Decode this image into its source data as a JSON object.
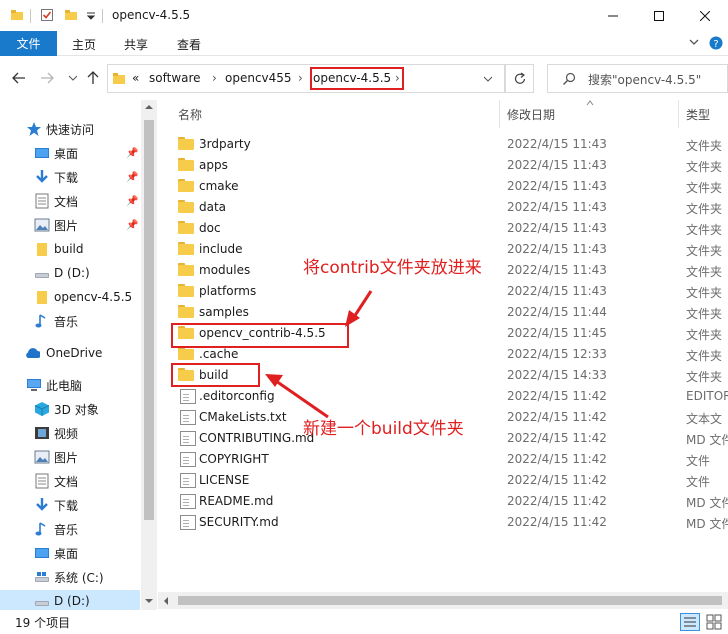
{
  "window": {
    "title": "opencv-4.5.5",
    "min_icon": "minimize-icon",
    "max_icon": "maximize-icon",
    "close_icon": "close-icon"
  },
  "ribbon": {
    "tabs": [
      "文件",
      "主页",
      "共享",
      "查看"
    ]
  },
  "address": {
    "crumbs": [
      "«",
      "software",
      "opencv455",
      "opencv-4.5.5"
    ],
    "search_placeholder": "搜索\"opencv-4.5.5\""
  },
  "nav": {
    "items": [
      {
        "label": "快速访问",
        "icon": "star-icon"
      },
      {
        "label": "桌面",
        "icon": "desktop-icon",
        "pinned": true
      },
      {
        "label": "下载",
        "icon": "download-icon",
        "pinned": true
      },
      {
        "label": "文档",
        "icon": "documents-icon",
        "pinned": true
      },
      {
        "label": "图片",
        "icon": "pictures-icon",
        "pinned": true
      },
      {
        "label": "build",
        "icon": "folder-icon"
      },
      {
        "label": "D (D:)",
        "icon": "drive-icon"
      },
      {
        "label": "opencv-4.5.5",
        "icon": "folder-icon"
      },
      {
        "label": "音乐",
        "icon": "music-icon"
      },
      {
        "label": "OneDrive",
        "icon": "cloud-icon"
      },
      {
        "label": "此电脑",
        "icon": "pc-icon"
      },
      {
        "label": "3D 对象",
        "icon": "3d-objects-icon"
      },
      {
        "label": "视频",
        "icon": "video-icon"
      },
      {
        "label": "图片",
        "icon": "pictures-icon"
      },
      {
        "label": "文档",
        "icon": "documents-icon"
      },
      {
        "label": "下载",
        "icon": "download-icon"
      },
      {
        "label": "音乐",
        "icon": "music-icon"
      },
      {
        "label": "桌面",
        "icon": "desktop-icon"
      },
      {
        "label": "系统 (C:)",
        "icon": "drive-icon"
      },
      {
        "label": "D (D:)",
        "icon": "drive-icon"
      }
    ]
  },
  "columns": {
    "name": "名称",
    "date": "修改日期",
    "type": "类型"
  },
  "files": [
    {
      "name": "3rdparty",
      "date": "2022/4/15 11:43",
      "type": "文件夹",
      "kind": "folder"
    },
    {
      "name": "apps",
      "date": "2022/4/15 11:43",
      "type": "文件夹",
      "kind": "folder"
    },
    {
      "name": "cmake",
      "date": "2022/4/15 11:43",
      "type": "文件夹",
      "kind": "folder"
    },
    {
      "name": "data",
      "date": "2022/4/15 11:43",
      "type": "文件夹",
      "kind": "folder"
    },
    {
      "name": "doc",
      "date": "2022/4/15 11:43",
      "type": "文件夹",
      "kind": "folder"
    },
    {
      "name": "include",
      "date": "2022/4/15 11:43",
      "type": "文件夹",
      "kind": "folder"
    },
    {
      "name": "modules",
      "date": "2022/4/15 11:43",
      "type": "文件夹",
      "kind": "folder"
    },
    {
      "name": "platforms",
      "date": "2022/4/15 11:43",
      "type": "文件夹",
      "kind": "folder"
    },
    {
      "name": "samples",
      "date": "2022/4/15 11:44",
      "type": "文件夹",
      "kind": "folder"
    },
    {
      "name": "opencv_contrib-4.5.5",
      "date": "2022/4/15 11:45",
      "type": "文件夹",
      "kind": "folder"
    },
    {
      "name": ".cache",
      "date": "2022/4/15 12:33",
      "type": "文件夹",
      "kind": "folder"
    },
    {
      "name": "build",
      "date": "2022/4/15 14:33",
      "type": "文件夹",
      "kind": "folder"
    },
    {
      "name": ".editorconfig",
      "date": "2022/4/15 11:42",
      "type": "EDITOR",
      "kind": "file"
    },
    {
      "name": "CMakeLists.txt",
      "date": "2022/4/15 11:42",
      "type": "文本文",
      "kind": "file"
    },
    {
      "name": "CONTRIBUTING.md",
      "date": "2022/4/15 11:42",
      "type": "MD 文件",
      "kind": "file"
    },
    {
      "name": "COPYRIGHT",
      "date": "2022/4/15 11:42",
      "type": "文件",
      "kind": "file"
    },
    {
      "name": "LICENSE",
      "date": "2022/4/15 11:42",
      "type": "文件",
      "kind": "file"
    },
    {
      "name": "README.md",
      "date": "2022/4/15 11:42",
      "type": "MD 文件",
      "kind": "file"
    },
    {
      "name": "SECURITY.md",
      "date": "2022/4/15 11:42",
      "type": "MD 文件",
      "kind": "file"
    }
  ],
  "status": {
    "count": "19 个项目"
  },
  "annotations": {
    "contrib_note": "将contrib文件夹放进来",
    "build_note": "新建一个build文件夹"
  },
  "colors": {
    "accent": "#1979ca",
    "annotation": "#e02020",
    "folder": "#f7cc4a"
  }
}
